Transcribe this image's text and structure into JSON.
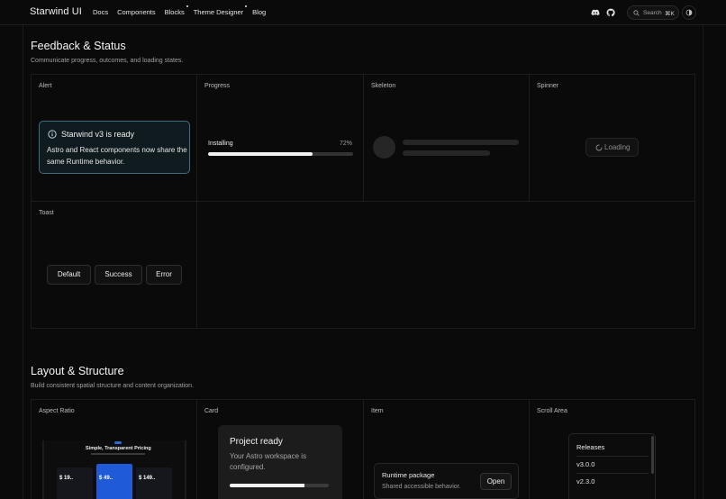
{
  "header": {
    "brand": "Starwind UI",
    "nav": [
      {
        "label": "Docs",
        "dot": false
      },
      {
        "label": "Components",
        "dot": false
      },
      {
        "label": "Blocks",
        "dot": true
      },
      {
        "label": "Theme Designer",
        "dot": true
      },
      {
        "label": "Blog",
        "dot": false
      }
    ],
    "search_label": "Search",
    "search_shortcut": "⌘K"
  },
  "feedback": {
    "title": "Feedback & Status",
    "description": "Communicate progress, outcomes, and loading states.",
    "alert": {
      "heading": "Alert",
      "title": "Starwind v3 is ready",
      "body": "Astro and React components now share the same Runtime behavior."
    },
    "progress": {
      "heading": "Progress",
      "label": "Installing",
      "value_text": "72%",
      "value": 0.72
    },
    "skeleton": {
      "heading": "Skeleton"
    },
    "spinner": {
      "heading": "Spinner",
      "label": "Loading"
    },
    "toast": {
      "heading": "Toast",
      "buttons": [
        "Default",
        "Success",
        "Error"
      ]
    }
  },
  "layout": {
    "title": "Layout & Structure",
    "description": "Build consistent spatial structure and content organization.",
    "aspect_ratio": {
      "heading": "Aspect Ratio",
      "preview_title": "Simple, Transparent Pricing",
      "preview_plans": [
        {
          "price": "$ 19.."
        },
        {
          "price": "$ 49.."
        },
        {
          "price": "$ 149.."
        }
      ]
    },
    "card": {
      "heading": "Card",
      "title": "Project ready",
      "description": "Your Astro workspace is configured.",
      "progress": 0.75
    },
    "item": {
      "heading": "Item",
      "title": "Runtime package",
      "description": "Shared accessible behavior.",
      "button": "Open"
    },
    "scroll_area": {
      "heading": "Scroll Area",
      "title": "Releases",
      "rows": [
        "v3.0.0",
        "v2.3.0"
      ]
    }
  },
  "colors": {
    "background": "#0a0a0a",
    "alert_border": "#3e6f7c",
    "accent_blue": "#1f5bd8"
  }
}
